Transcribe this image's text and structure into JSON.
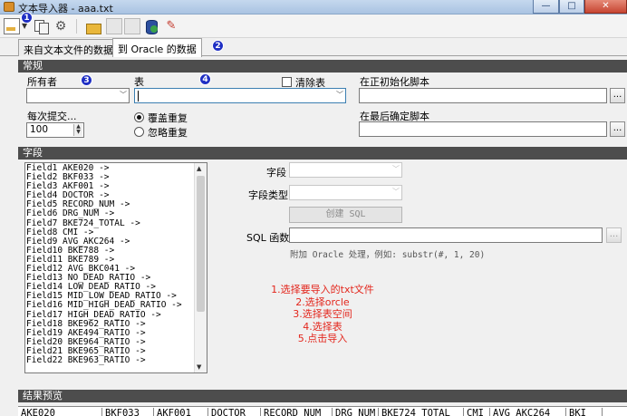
{
  "window": {
    "title": "文本导入器 - aaa.txt",
    "minimize": "—",
    "maximize": "□",
    "close": "✕"
  },
  "markers": [
    "1",
    "2",
    "3",
    "4"
  ],
  "tabs": [
    "来自文本文件的数据",
    "到 Oracle 的数据"
  ],
  "general": {
    "header": "常规",
    "owner_label": "所有者",
    "table_label": "表",
    "clear_table_label": "清除表",
    "commit_label": "每次提交...",
    "commit_value": "100",
    "overwrite_label": "覆盖重复",
    "ignore_label": "忽略重复",
    "init_script_label": "在正初始化脚本",
    "final_script_label": "在最后确定脚本",
    "browse": "..."
  },
  "fields_section": {
    "header": "字段",
    "items": [
      "Field1  AKE020  ->",
      "Field2  BKF033  ->",
      "Field3  AKF001  ->",
      "Field4  DOCTOR  ->",
      "Field5  RECORD_NUM  ->",
      "Field6  DRG_NUM  ->",
      "Field7  BKE724_TOTAL  ->",
      "Field8  CMI  ->",
      "Field9  AVG_AKC264  ->",
      "Field10  BKE788  ->",
      "Field11  BKE789  ->",
      "Field12  AVG_BKC041  ->",
      "Field13  NO_DEAD_RATIO  ->",
      "Field14  LOW_DEAD_RATIO  ->",
      "Field15  MID_LOW_DEAD_RATIO  ->",
      "Field16  MID_HIGH_DEAD_RATIO  ->",
      "Field17  HIGH_DEAD_RATIO  ->",
      "Field18  BKE962_RATIO  ->",
      "Field19  AKE494_RATIO  ->",
      "Field20  BKE964_RATIO  ->",
      "Field21  BKE965_RATIO  ->",
      "Field22  BKE963_RATIO  ->"
    ],
    "field_label": "字段",
    "field_type_label": "字段类型",
    "create_sql_button": "创建 SQL",
    "sql_function_label": "SQL 函数",
    "sql_hint": "附加 Oracle 处理，例如: substr(#, 1, 20)"
  },
  "notes": [
    "1.选择要导入的txt文件",
    "2.选择orcle",
    "3.选择表空间",
    "4.选择表",
    "5.点击导入"
  ],
  "preview": {
    "header": "结果预览",
    "columns": [
      "AKE020",
      "BKF033",
      "AKF001",
      "DOCTOR",
      "RECORD_NUM",
      "DRG_NUM",
      "BKE724_TOTAL",
      "CMI",
      "AVG_AKC264",
      "BKI"
    ]
  }
}
